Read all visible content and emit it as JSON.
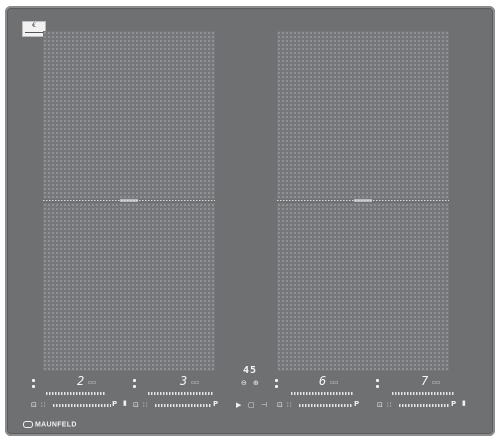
{
  "appliance": {
    "brand": "MAUNFELD",
    "timer_display": "45",
    "zones": [
      {
        "id": "rear-left"
      },
      {
        "id": "front-left"
      },
      {
        "id": "rear-right"
      },
      {
        "id": "front-right"
      }
    ],
    "controls": [
      {
        "level": "2",
        "boost_label": "P"
      },
      {
        "level": "3",
        "boost_label": "P"
      },
      {
        "level": "6",
        "boost_label": "P"
      },
      {
        "level": "7",
        "boost_label": "P"
      }
    ],
    "icons": {
      "power": "power-icon",
      "lock": "lock-icon",
      "timer_minus": "timer-minus-icon",
      "timer_plus": "timer-plus-icon",
      "play": "play-icon",
      "stop": "stop-icon"
    },
    "center_controls": {
      "left_symbol": "▶",
      "mid_symbol": "▢",
      "right_symbol": "⊣"
    },
    "colors": {
      "glass": "#6e7072",
      "zone": "#75777a",
      "indicator": "#f1f3f5"
    }
  }
}
